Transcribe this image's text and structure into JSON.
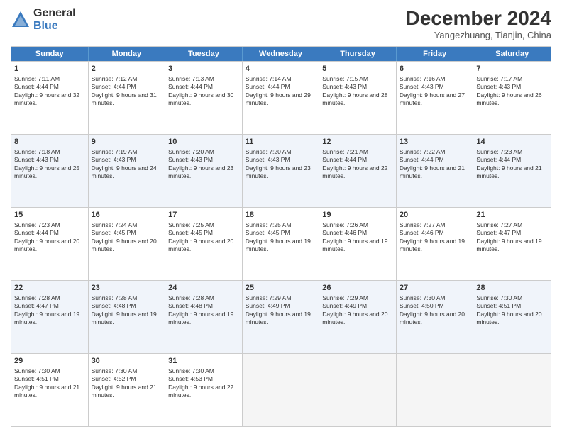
{
  "logo": {
    "general": "General",
    "blue": "Blue"
  },
  "header": {
    "month": "December 2024",
    "location": "Yangezhuang, Tianjin, China"
  },
  "days": [
    "Sunday",
    "Monday",
    "Tuesday",
    "Wednesday",
    "Thursday",
    "Friday",
    "Saturday"
  ],
  "rows": [
    [
      {
        "num": "1",
        "sunrise": "7:11 AM",
        "sunset": "4:44 PM",
        "daylight": "9 hours and 32 minutes."
      },
      {
        "num": "2",
        "sunrise": "7:12 AM",
        "sunset": "4:44 PM",
        "daylight": "9 hours and 31 minutes."
      },
      {
        "num": "3",
        "sunrise": "7:13 AM",
        "sunset": "4:44 PM",
        "daylight": "9 hours and 30 minutes."
      },
      {
        "num": "4",
        "sunrise": "7:14 AM",
        "sunset": "4:44 PM",
        "daylight": "9 hours and 29 minutes."
      },
      {
        "num": "5",
        "sunrise": "7:15 AM",
        "sunset": "4:43 PM",
        "daylight": "9 hours and 28 minutes."
      },
      {
        "num": "6",
        "sunrise": "7:16 AM",
        "sunset": "4:43 PM",
        "daylight": "9 hours and 27 minutes."
      },
      {
        "num": "7",
        "sunrise": "7:17 AM",
        "sunset": "4:43 PM",
        "daylight": "9 hours and 26 minutes."
      }
    ],
    [
      {
        "num": "8",
        "sunrise": "7:18 AM",
        "sunset": "4:43 PM",
        "daylight": "9 hours and 25 minutes."
      },
      {
        "num": "9",
        "sunrise": "7:19 AM",
        "sunset": "4:43 PM",
        "daylight": "9 hours and 24 minutes."
      },
      {
        "num": "10",
        "sunrise": "7:20 AM",
        "sunset": "4:43 PM",
        "daylight": "9 hours and 23 minutes."
      },
      {
        "num": "11",
        "sunrise": "7:20 AM",
        "sunset": "4:43 PM",
        "daylight": "9 hours and 23 minutes."
      },
      {
        "num": "12",
        "sunrise": "7:21 AM",
        "sunset": "4:44 PM",
        "daylight": "9 hours and 22 minutes."
      },
      {
        "num": "13",
        "sunrise": "7:22 AM",
        "sunset": "4:44 PM",
        "daylight": "9 hours and 21 minutes."
      },
      {
        "num": "14",
        "sunrise": "7:23 AM",
        "sunset": "4:44 PM",
        "daylight": "9 hours and 21 minutes."
      }
    ],
    [
      {
        "num": "15",
        "sunrise": "7:23 AM",
        "sunset": "4:44 PM",
        "daylight": "9 hours and 20 minutes."
      },
      {
        "num": "16",
        "sunrise": "7:24 AM",
        "sunset": "4:45 PM",
        "daylight": "9 hours and 20 minutes."
      },
      {
        "num": "17",
        "sunrise": "7:25 AM",
        "sunset": "4:45 PM",
        "daylight": "9 hours and 20 minutes."
      },
      {
        "num": "18",
        "sunrise": "7:25 AM",
        "sunset": "4:45 PM",
        "daylight": "9 hours and 19 minutes."
      },
      {
        "num": "19",
        "sunrise": "7:26 AM",
        "sunset": "4:46 PM",
        "daylight": "9 hours and 19 minutes."
      },
      {
        "num": "20",
        "sunrise": "7:27 AM",
        "sunset": "4:46 PM",
        "daylight": "9 hours and 19 minutes."
      },
      {
        "num": "21",
        "sunrise": "7:27 AM",
        "sunset": "4:47 PM",
        "daylight": "9 hours and 19 minutes."
      }
    ],
    [
      {
        "num": "22",
        "sunrise": "7:28 AM",
        "sunset": "4:47 PM",
        "daylight": "9 hours and 19 minutes."
      },
      {
        "num": "23",
        "sunrise": "7:28 AM",
        "sunset": "4:48 PM",
        "daylight": "9 hours and 19 minutes."
      },
      {
        "num": "24",
        "sunrise": "7:28 AM",
        "sunset": "4:48 PM",
        "daylight": "9 hours and 19 minutes."
      },
      {
        "num": "25",
        "sunrise": "7:29 AM",
        "sunset": "4:49 PM",
        "daylight": "9 hours and 19 minutes."
      },
      {
        "num": "26",
        "sunrise": "7:29 AM",
        "sunset": "4:49 PM",
        "daylight": "9 hours and 20 minutes."
      },
      {
        "num": "27",
        "sunrise": "7:30 AM",
        "sunset": "4:50 PM",
        "daylight": "9 hours and 20 minutes."
      },
      {
        "num": "28",
        "sunrise": "7:30 AM",
        "sunset": "4:51 PM",
        "daylight": "9 hours and 20 minutes."
      }
    ],
    [
      {
        "num": "29",
        "sunrise": "7:30 AM",
        "sunset": "4:51 PM",
        "daylight": "9 hours and 21 minutes."
      },
      {
        "num": "30",
        "sunrise": "7:30 AM",
        "sunset": "4:52 PM",
        "daylight": "9 hours and 21 minutes."
      },
      {
        "num": "31",
        "sunrise": "7:30 AM",
        "sunset": "4:53 PM",
        "daylight": "9 hours and 22 minutes."
      },
      null,
      null,
      null,
      null
    ]
  ]
}
